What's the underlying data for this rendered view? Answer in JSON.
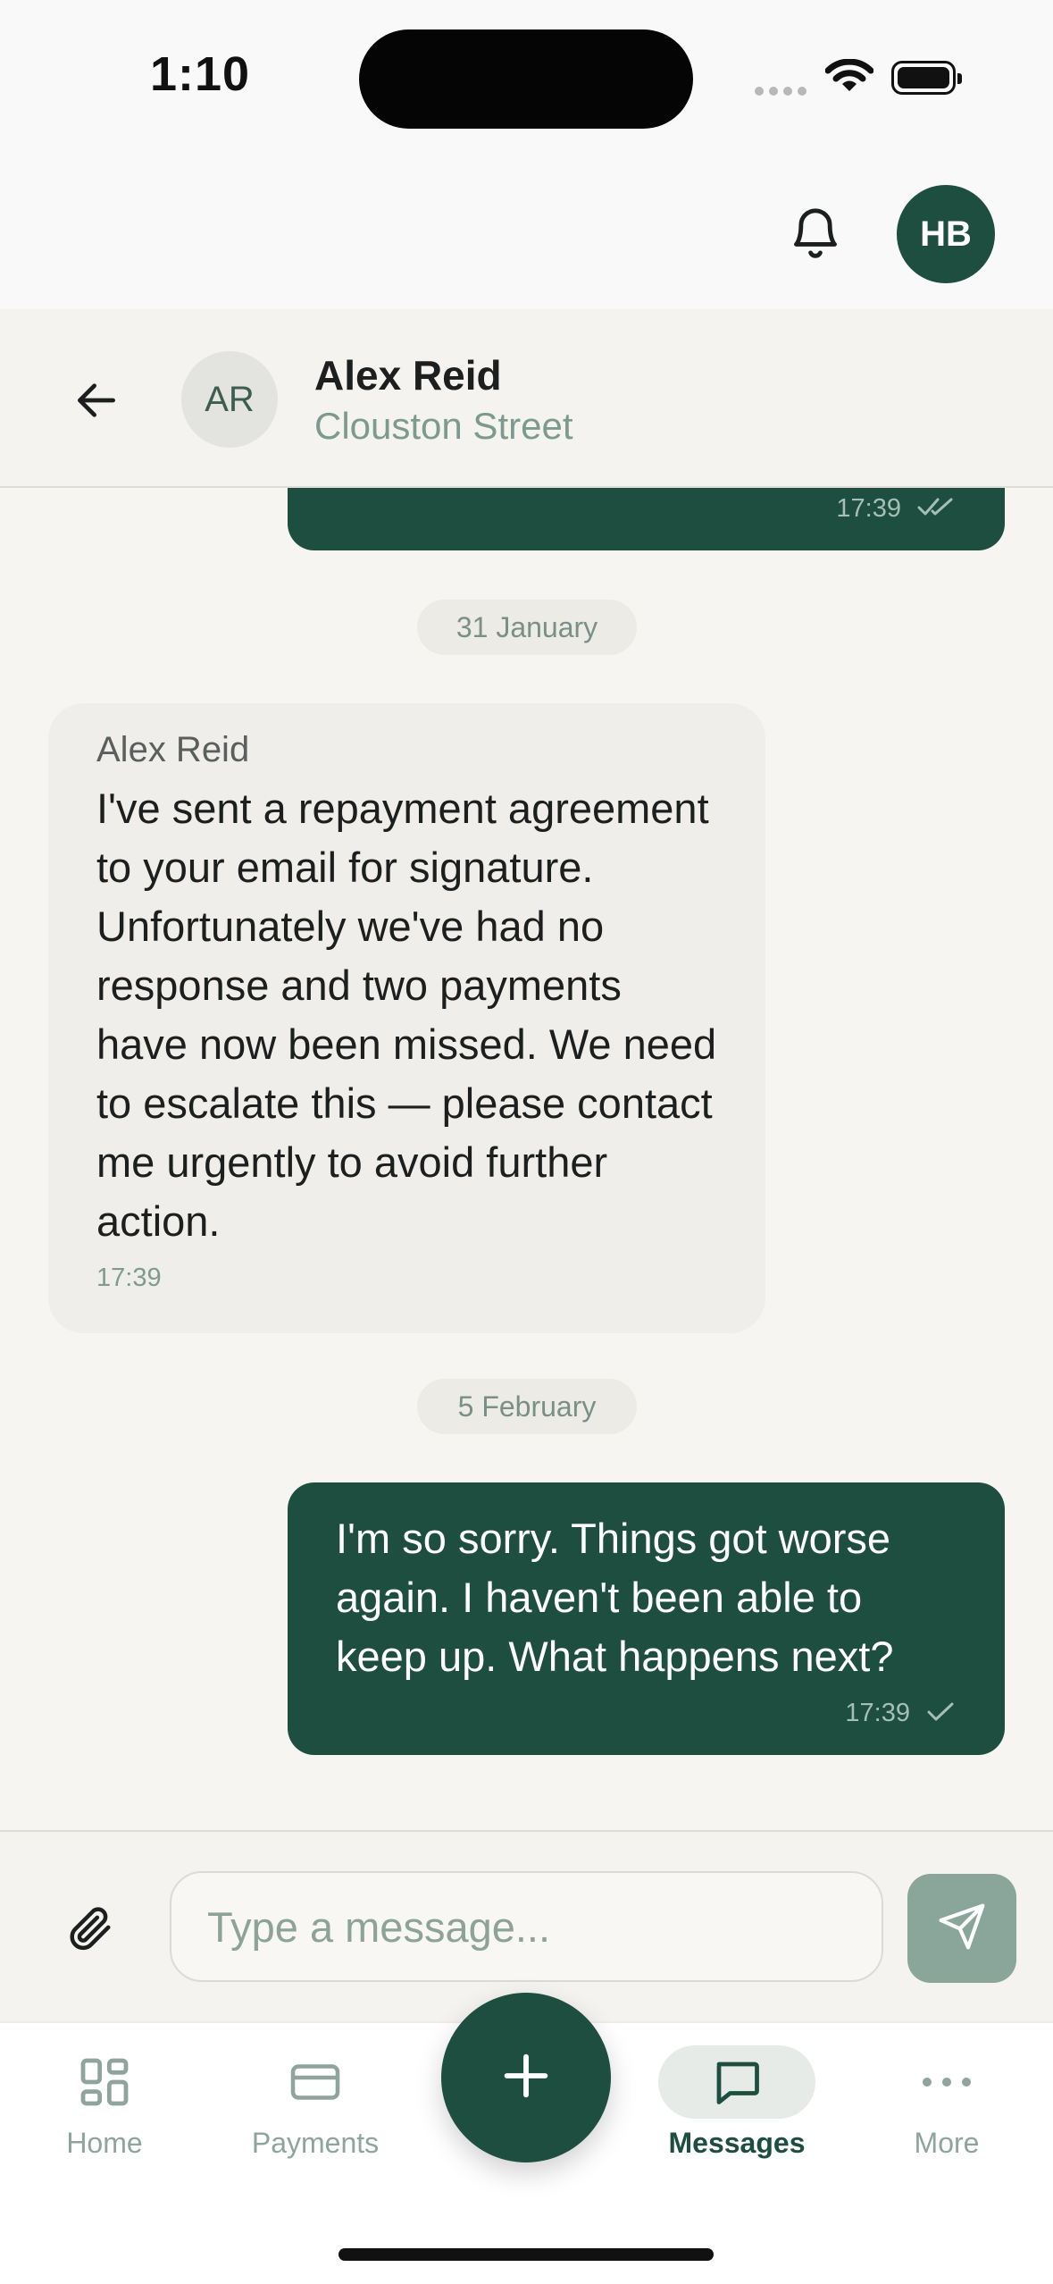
{
  "status_bar": {
    "time": "1:10"
  },
  "header": {
    "user_initials": "HB"
  },
  "chat": {
    "contact_initials": "AR",
    "contact_name": "Alex Reid",
    "contact_subtitle": "Clouston Street"
  },
  "messages": {
    "prev_out_time": "17:39",
    "date1": "31 January",
    "incoming": {
      "sender": "Alex Reid",
      "text": "I've sent a repayment agreement to your email for signature. Unfortunately we've had no response and two payments have now been missed. We need to escalate this — please contact me urgently to avoid further action.",
      "time": "17:39"
    },
    "date2": "5 February",
    "outgoing": {
      "text": "I'm so sorry. Things got worse again. I haven't been able to keep up. What happens next?",
      "time": "17:39"
    }
  },
  "composer": {
    "placeholder": "Type a message..."
  },
  "tabs": {
    "home": "Home",
    "payments": "Payments",
    "messages": "Messages",
    "more": "More"
  },
  "colors": {
    "brand": "#1e4e40",
    "send_disabled": "#8aa59a"
  }
}
